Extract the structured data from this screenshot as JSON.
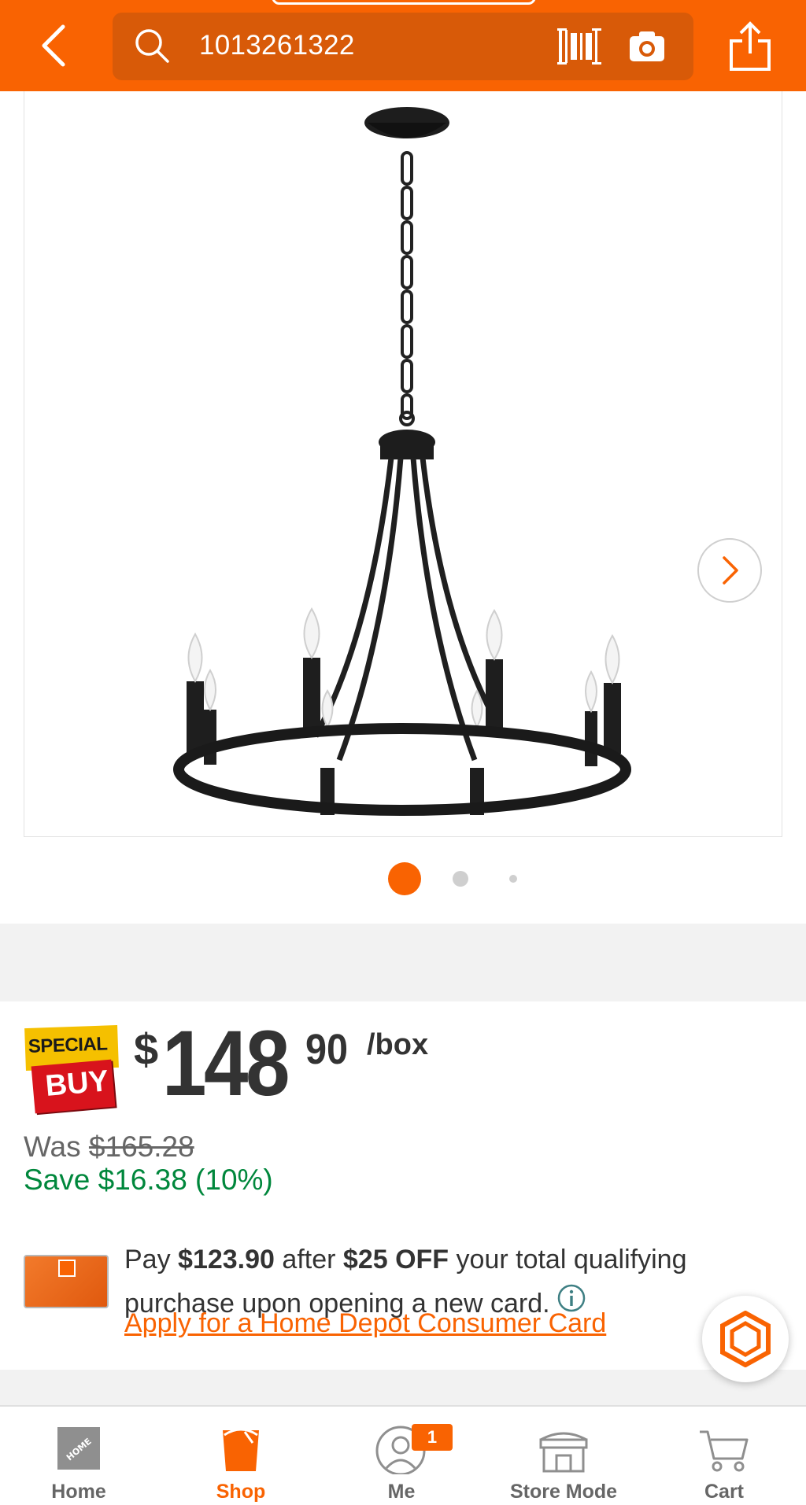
{
  "header": {
    "search_value": "1013261322",
    "icons": [
      "back-arrow-icon",
      "search-icon",
      "barcode-icon",
      "camera-icon",
      "share-icon"
    ]
  },
  "gallery": {
    "image_subject": "wagon wheel chandelier",
    "current_index": 1,
    "total_images": 3
  },
  "pricing": {
    "badge_top": "SPECIAL",
    "badge_bottom": "BUY",
    "currency": "$",
    "price_whole": "148",
    "price_cents": "90",
    "unit": "/box",
    "was_label": "Was",
    "was_price": "$165.28",
    "save_text": "Save $16.38 (10%)"
  },
  "promo": {
    "text_pay": "Pay",
    "amount": "$123.90",
    "text_after": "after",
    "discount": "$25 OFF",
    "text_rest": "your total qualifying purchase upon opening a new card.",
    "apply_link": "Apply for a Home Depot Consumer Card"
  },
  "bottom_nav": {
    "items": [
      {
        "label": "Home",
        "icon": "home-depot-logo-icon",
        "active": false
      },
      {
        "label": "Shop",
        "icon": "bucket-icon",
        "active": true
      },
      {
        "label": "Me",
        "icon": "user-icon",
        "active": false,
        "badge": "1"
      },
      {
        "label": "Store Mode",
        "icon": "store-icon",
        "active": false
      },
      {
        "label": "Cart",
        "icon": "cart-icon",
        "active": false
      }
    ]
  },
  "colors": {
    "brand_orange": "#f96302",
    "save_green": "#00873c",
    "badge_yellow": "#f5c000",
    "badge_red": "#d8131c"
  }
}
